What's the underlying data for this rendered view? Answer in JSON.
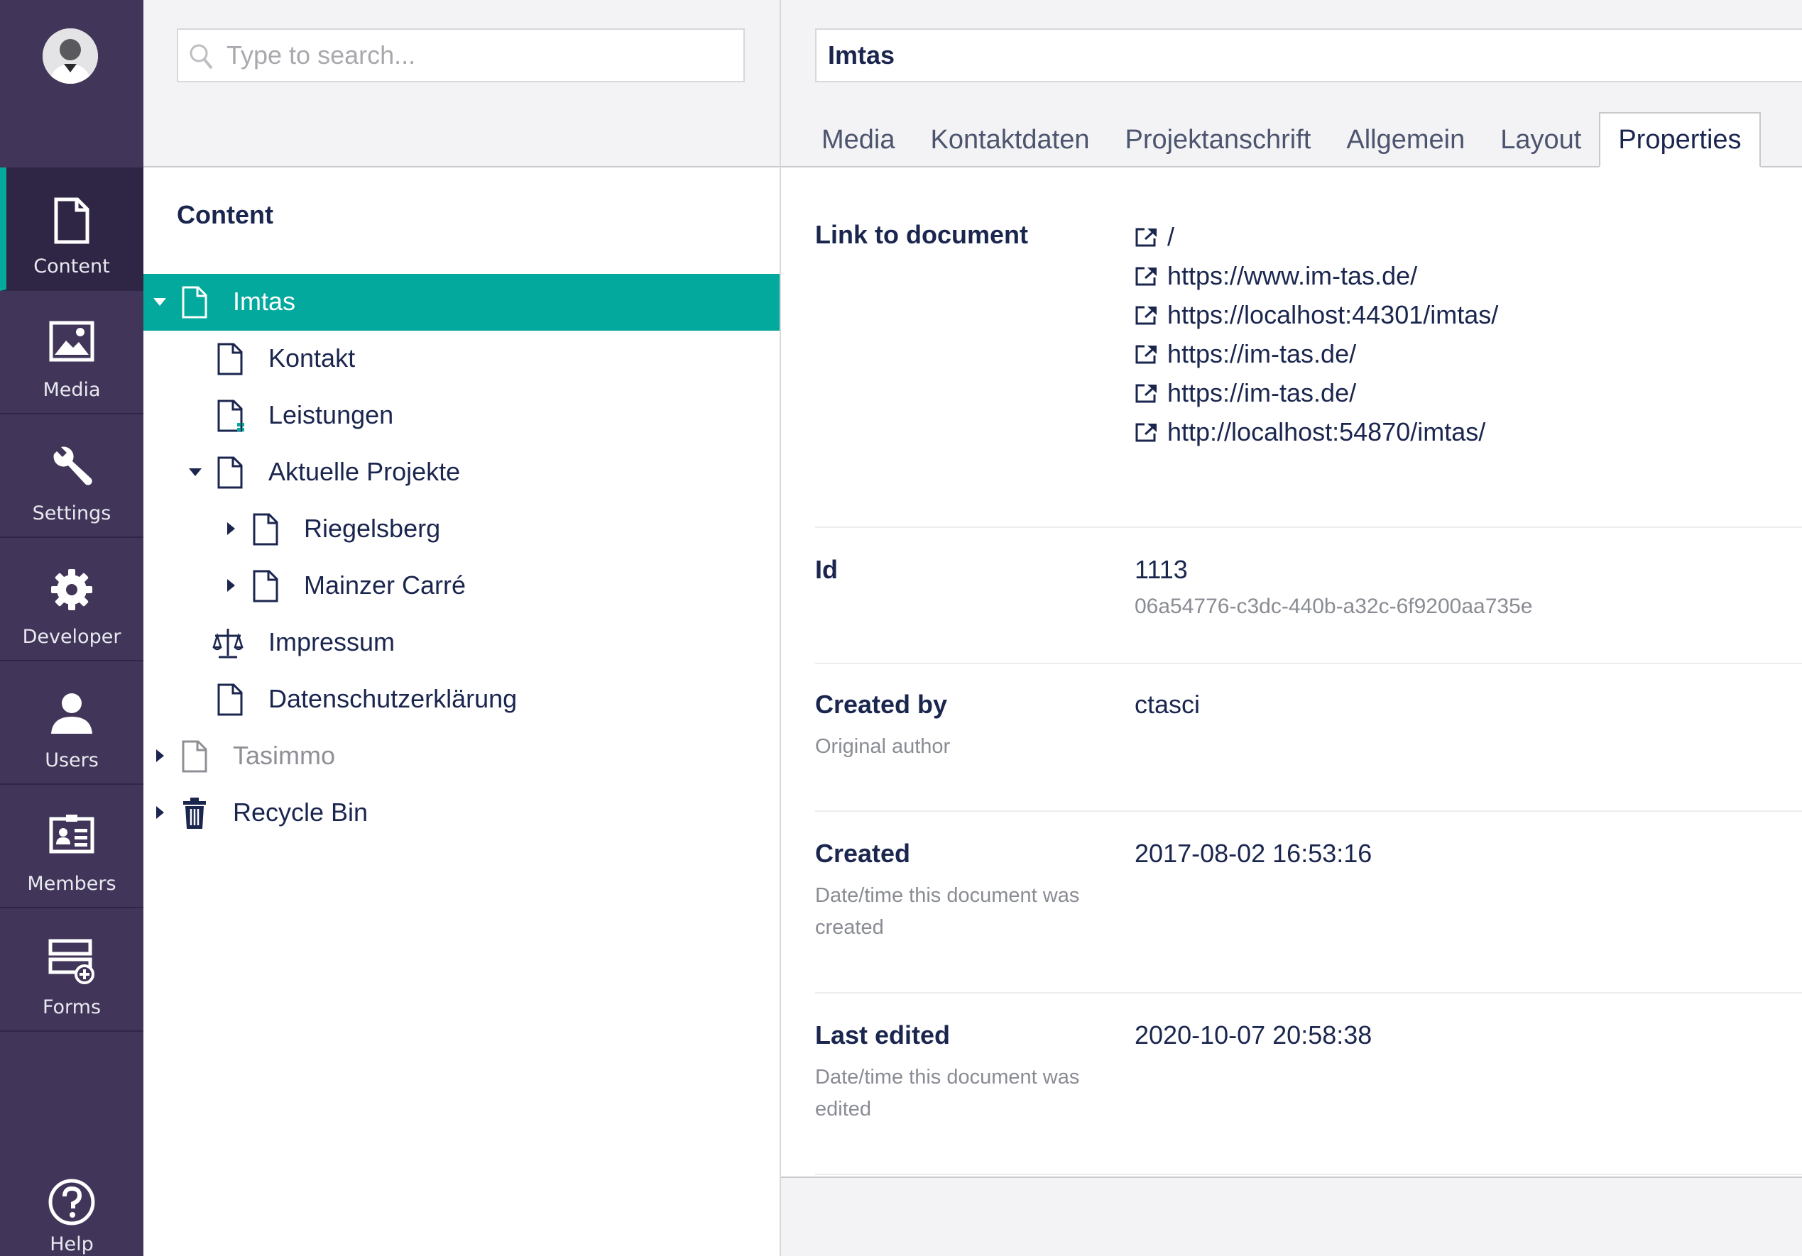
{
  "appnav": {
    "items": [
      {
        "label": "Content",
        "icon": "document-icon"
      },
      {
        "label": "Media",
        "icon": "image-icon"
      },
      {
        "label": "Settings",
        "icon": "wrench-icon"
      },
      {
        "label": "Developer",
        "icon": "gear-icon"
      },
      {
        "label": "Users",
        "icon": "user-icon"
      },
      {
        "label": "Members",
        "icon": "id-card-icon"
      },
      {
        "label": "Forms",
        "icon": "forms-icon"
      }
    ],
    "help_label": "Help"
  },
  "search": {
    "placeholder": "Type to search..."
  },
  "tree": {
    "title": "Content",
    "nodes": [
      {
        "label": "Imtas"
      },
      {
        "label": "Kontakt"
      },
      {
        "label": "Leistungen"
      },
      {
        "label": "Aktuelle Projekte"
      },
      {
        "label": "Riegelsberg"
      },
      {
        "label": "Mainzer Carré"
      },
      {
        "label": "Impressum"
      },
      {
        "label": "Datenschutzerklärung"
      },
      {
        "label": "Tasimmo"
      },
      {
        "label": "Recycle Bin"
      }
    ]
  },
  "editor": {
    "name_value": "Imtas",
    "tabs": [
      "Media",
      "Kontaktdaten",
      "Projektanschrift",
      "Allgemein",
      "Layout",
      "Properties"
    ],
    "active_tab": "Properties",
    "properties": {
      "link_label": "Link to document",
      "links": [
        "/",
        "https://www.im-tas.de/",
        "https://localhost:44301/imtas/",
        "https://im-tas.de/",
        "https://im-tas.de/",
        "http://localhost:54870/imtas/"
      ],
      "id_label": "Id",
      "id_value": "1113",
      "guid_value": "06a54776-c3dc-440b-a32c-6f9200aa735e",
      "created_by_label": "Created by",
      "created_by_desc": "Original author",
      "created_by_value": "ctasci",
      "created_label": "Created",
      "created_desc": "Date/time this document was created",
      "created_value": "2017-08-02 16:53:16",
      "edited_label": "Last edited",
      "edited_desc": "Date/time this document was edited",
      "edited_value": "2020-10-07 20:58:38"
    }
  },
  "colors": {
    "sidebar": "#413659",
    "accent": "#03a99d",
    "text": "#1b264f"
  }
}
